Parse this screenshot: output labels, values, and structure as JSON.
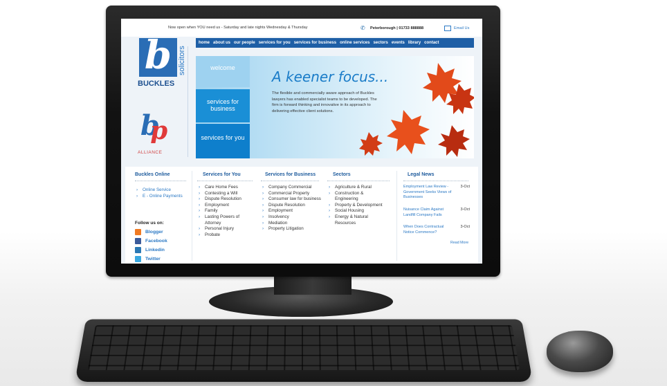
{
  "topbar": {
    "message": "Now open when YOU need us - Saturday and late nights Wednesday & Thursday",
    "phone": "Peterborough | 01733 888888",
    "email": "Email Us"
  },
  "nav": [
    "home",
    "about us",
    "our people",
    "services for you",
    "services for business",
    "online services",
    "sectors",
    "events",
    "library",
    "contact"
  ],
  "logo": {
    "mark": "b",
    "vertical": "solicitors",
    "name": "BUCKLES",
    "alliance": "ALLIANCE"
  },
  "hero": {
    "tab_welcome": "welcome",
    "tab_business": "services for business",
    "tab_you": "services for you",
    "title": "A keener focus...",
    "text": "The flexible and commercially aware approach of Buckles lawyers has enabled specialist teams to be developed. The firm is forward thinking and innovative in its approach to delivering effective client solutions."
  },
  "buckles_online": {
    "title": "Buckles Online",
    "items": [
      "Online Service",
      "E - Online Payments"
    ],
    "follow_label": "Follow us on:",
    "social": [
      {
        "label": "Blogger",
        "icon": "blogger-icon",
        "color": "#f07a22"
      },
      {
        "label": "Facebook",
        "icon": "facebook-icon",
        "color": "#3b5a9a"
      },
      {
        "label": "Linkedin",
        "icon": "linkedin-icon",
        "color": "#2a78b4"
      },
      {
        "label": "Twitter",
        "icon": "twitter-icon",
        "color": "#3aa8e0"
      }
    ]
  },
  "services_you": {
    "title": "Services for You",
    "items": [
      "Care Home Fees",
      "Contesting a Will",
      "Dispute Resolution",
      "Employment",
      "Family",
      "Lasting Powers of Attorney",
      "Personal Injury",
      "Probate"
    ]
  },
  "services_business": {
    "title": "Services for Business",
    "items": [
      "Company Commercial",
      "Commercial Property",
      "Consumer law for business",
      "Dispute Resolution",
      "Employment",
      "Insolvency",
      "Mediation",
      "Property Litigation"
    ]
  },
  "sectors": {
    "title": "Sectors",
    "items": [
      "Agriculture & Rural",
      "Construction & Engineering",
      "Property & Development",
      "Social Housing",
      "Energy & Natural Resources"
    ]
  },
  "legal_news": {
    "title": "Legal News",
    "items": [
      {
        "title": "Employment Law Review - Government Seeks Views of Businesses",
        "date": "3-Oct"
      },
      {
        "title": "Nuisance Claim Against Landfill Company Fails",
        "date": "3-Oct"
      },
      {
        "title": "When Does Contractual Notice Commence?",
        "date": "3-Oct"
      }
    ],
    "read_more": "Read More"
  },
  "colors": {
    "brand_blue": "#1e5fa6",
    "accent": "#1a8fd6",
    "link": "#2a78c4"
  }
}
